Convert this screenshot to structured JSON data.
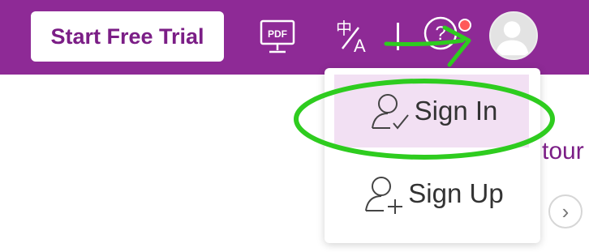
{
  "header": {
    "trial_label": "Start Free Trial",
    "pdf_icon_label": "PDF",
    "lang_icon": "translate-icon",
    "help_icon": "help-icon",
    "avatar_icon": "user-avatar"
  },
  "menu": {
    "items": [
      {
        "label": "Sign In",
        "icon": "user-check-icon"
      },
      {
        "label": "Sign Up",
        "icon": "user-plus-icon"
      }
    ]
  },
  "background": {
    "tour_text": "tour",
    "next_glyph": "›"
  },
  "colors": {
    "brand": "#8e2a96",
    "accent_text": "#7b1e86",
    "highlight": "#f2e0f3",
    "annotation_green": "#2ecc1f"
  }
}
